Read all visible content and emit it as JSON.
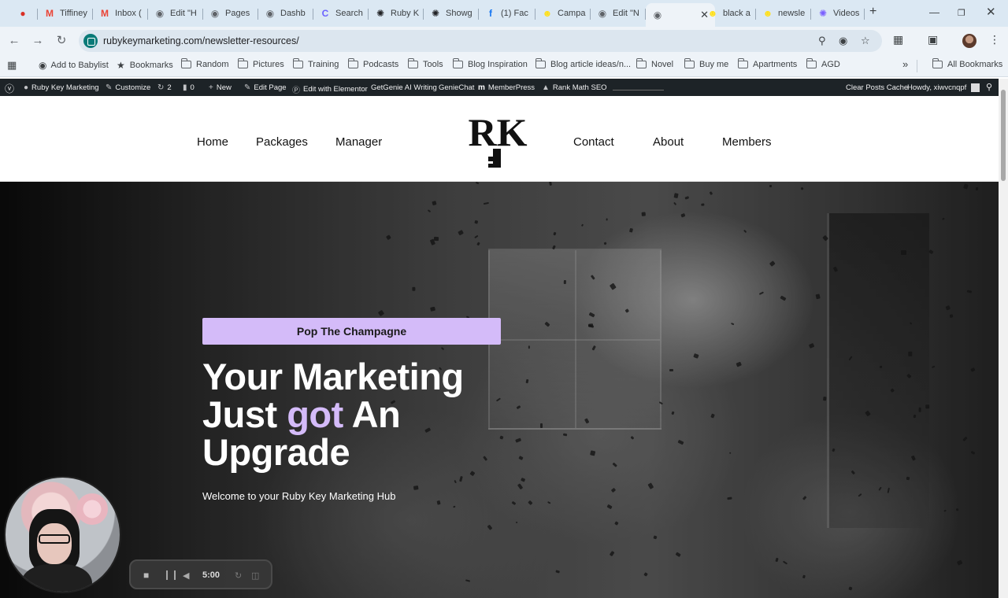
{
  "browser": {
    "tabs": [
      {
        "title": "",
        "icon": "record-icon",
        "color": "#d93025"
      },
      {
        "title": "Tiffiney",
        "icon": "gmail-icon",
        "color": "#ea4335"
      },
      {
        "title": "Inbox (",
        "icon": "gmail-icon",
        "color": "#ea4335"
      },
      {
        "title": "Edit \"H",
        "icon": "globe-icon",
        "color": "#5f6368"
      },
      {
        "title": "Pages",
        "icon": "globe-icon",
        "color": "#5f6368"
      },
      {
        "title": "Dashb",
        "icon": "globe-icon",
        "color": "#5f6368"
      },
      {
        "title": "Search",
        "icon": "search-app-icon",
        "color": "#6c63ff"
      },
      {
        "title": "Ruby K",
        "icon": "openai-icon",
        "color": "#202124"
      },
      {
        "title": "Showg",
        "icon": "openai-icon",
        "color": "#202124"
      },
      {
        "title": "(1) Fac",
        "icon": "facebook-icon",
        "color": "#1877f2"
      },
      {
        "title": "Campa",
        "icon": "mailchimp-icon",
        "color": "#ffe01b"
      },
      {
        "title": "Edit \"N",
        "icon": "globe-icon",
        "color": "#5f6368"
      },
      {
        "title": "",
        "icon": "globe-icon",
        "color": "#5f6368",
        "active": true
      },
      {
        "title": "black a",
        "icon": "mailchimp-icon",
        "color": "#ffe01b"
      },
      {
        "title": "newsle",
        "icon": "mailchimp-icon",
        "color": "#ffe01b"
      },
      {
        "title": "Videos",
        "icon": "gear-flower-icon",
        "color": "#7b61ff"
      }
    ],
    "new_tab": "+",
    "url": "rubykeymarketing.com/newsletter-resources/"
  },
  "bookmarks": [
    {
      "label": "Add to Babylist",
      "type": "globe"
    },
    {
      "label": "Bookmarks",
      "type": "star"
    },
    {
      "label": "Random",
      "type": "folder"
    },
    {
      "label": "Pictures",
      "type": "folder"
    },
    {
      "label": "Training",
      "type": "folder"
    },
    {
      "label": "Podcasts",
      "type": "folder"
    },
    {
      "label": "Tools",
      "type": "folder"
    },
    {
      "label": "Blog Inspiration",
      "type": "folder"
    },
    {
      "label": "Blog article ideas/n...",
      "type": "folder"
    },
    {
      "label": "Novel",
      "type": "folder"
    },
    {
      "label": "Buy me",
      "type": "folder"
    },
    {
      "label": "Apartments",
      "type": "folder"
    },
    {
      "label": "AGD",
      "type": "folder"
    }
  ],
  "bookmarks_more": "»",
  "all_bookmarks": "All Bookmarks",
  "wpadmin": {
    "site": "Ruby Key Marketing",
    "customize": "Customize",
    "updates": "2",
    "comments": "0",
    "new": "New",
    "edit_page": "Edit Page",
    "elementor": "Edit with Elementor",
    "getgenie": "GetGenie AI Writing",
    "geniechat": "GenieChat",
    "memberpress": "MemberPress",
    "rankmath": "Rank Math SEO",
    "clear_cache": "Clear Posts Cache",
    "howdy": "Howdy, xiwvcnqpf"
  },
  "site_nav": {
    "left": [
      "Home",
      "Packages",
      "Manager"
    ],
    "right": [
      "Contact",
      "About",
      "Members"
    ],
    "logo_text": "RK"
  },
  "hero": {
    "badge": "Pop The Champagne",
    "headline_line1": "Your Marketing",
    "headline_line2_a": "Just ",
    "headline_line2_accent": "got",
    "headline_line2_b": " An",
    "headline_line3": "Upgrade",
    "subline": "Welcome to your Ruby Key Marketing Hub",
    "accent_color": "#d4bbf9"
  },
  "recorder": {
    "time": "5:00"
  }
}
